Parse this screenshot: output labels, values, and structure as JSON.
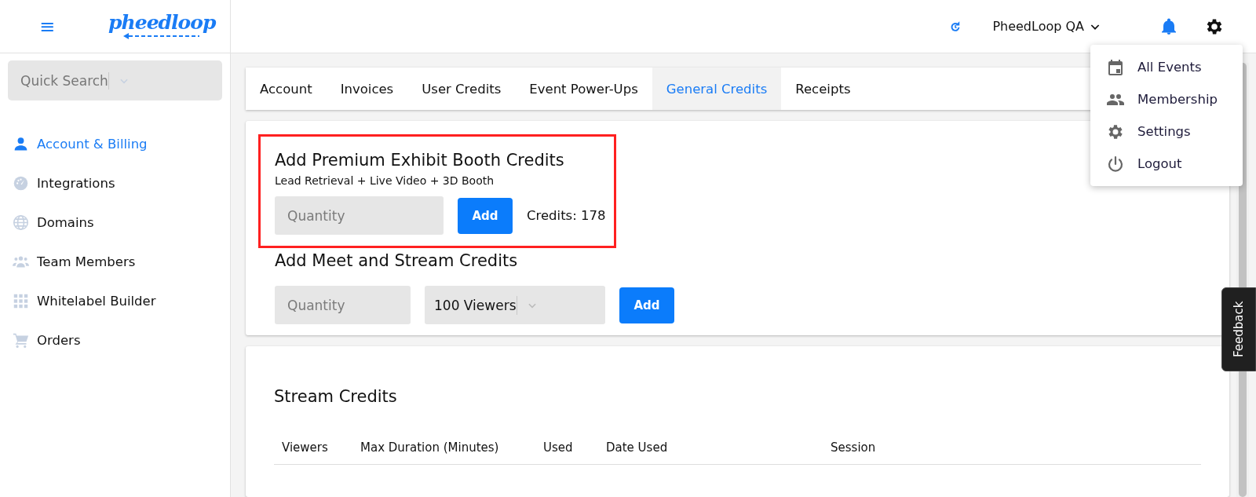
{
  "header": {
    "menu_glyph": "≡",
    "logo": "pheedloop",
    "organization": "PheedLoop QA"
  },
  "account_menu": {
    "items": [
      {
        "label": "All Events"
      },
      {
        "label": "Membership"
      },
      {
        "label": "Settings"
      },
      {
        "label": "Logout"
      }
    ]
  },
  "sidebar": {
    "search": {
      "placeholder": "Quick Search"
    },
    "items": [
      {
        "label": "Account & Billing",
        "selected": true
      },
      {
        "label": "Integrations",
        "selected": false
      },
      {
        "label": "Domains",
        "selected": false
      },
      {
        "label": "Team Members",
        "selected": false
      },
      {
        "label": "Whitelabel Builder",
        "selected": false
      },
      {
        "label": "Orders",
        "selected": false
      }
    ]
  },
  "tabs": [
    {
      "label": "Account",
      "selected": false
    },
    {
      "label": "Invoices",
      "selected": false
    },
    {
      "label": "User Credits",
      "selected": false
    },
    {
      "label": "Event Power-Ups",
      "selected": false
    },
    {
      "label": "General Credits",
      "selected": true
    },
    {
      "label": "Receipts",
      "selected": false
    }
  ],
  "booth_credits": {
    "title": "Add Premium Exhibit Booth Credits",
    "subtitle": "Lead Retrieval + Live Video + 3D Booth",
    "quantity": {
      "placeholder": "Quantity"
    },
    "button": "Add",
    "credits": "Credits: 178",
    "highlighted": true
  },
  "meet_stream_credits": {
    "title": "Add Meet and Stream Credits",
    "quantity": {
      "placeholder": "Quantity"
    },
    "viewers": "100 Viewers",
    "button": "Add"
  },
  "stream_credits": {
    "title": "Stream Credits",
    "columns": [
      "Viewers",
      "Max Duration (Minutes)",
      "Used",
      "Date Used",
      "Session"
    ]
  },
  "feedback": "Feedback"
}
